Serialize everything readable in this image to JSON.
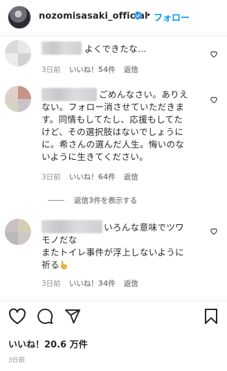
{
  "header": {
    "username": "nozomisasaki_official",
    "separator": "•",
    "follow_label": "フォロー"
  },
  "comments": [
    {
      "text": "よくできたな…",
      "time": "3日前",
      "likes": "いいね！54件",
      "reply": "返信"
    },
    {
      "lines": [
        "ごめんなさい。ありえ",
        "ない。フォロー消させていただきま",
        "す。同情もしてたし、応援もしてた",
        "けど、その選択肢はないでしょうに",
        "に。希さんの選んだ人生。悔いのな",
        "いように生きてください。"
      ],
      "time": "3日前",
      "likes": "いいね！64件",
      "reply": "返信"
    },
    {
      "lines": [
        "いろんな意味でツワ",
        "モノだな",
        "またトイレ事件が浮上しないように",
        "祈る"
      ],
      "time": "3日前",
      "likes": "いいね！34件",
      "reply": "返信"
    }
  ],
  "view_replies": "返信3件を表示する",
  "post": {
    "likes_label": "いいね！20.6 万件",
    "date": "3日前"
  },
  "colors": {
    "accent": "#0095f6",
    "verified": "#3897f0",
    "muted": "#8e8e8e"
  },
  "icons": [
    "verified-badge-icon",
    "heart-icon",
    "comment-icon",
    "share-icon",
    "bookmark-icon",
    "pointing-hand-emoji"
  ]
}
